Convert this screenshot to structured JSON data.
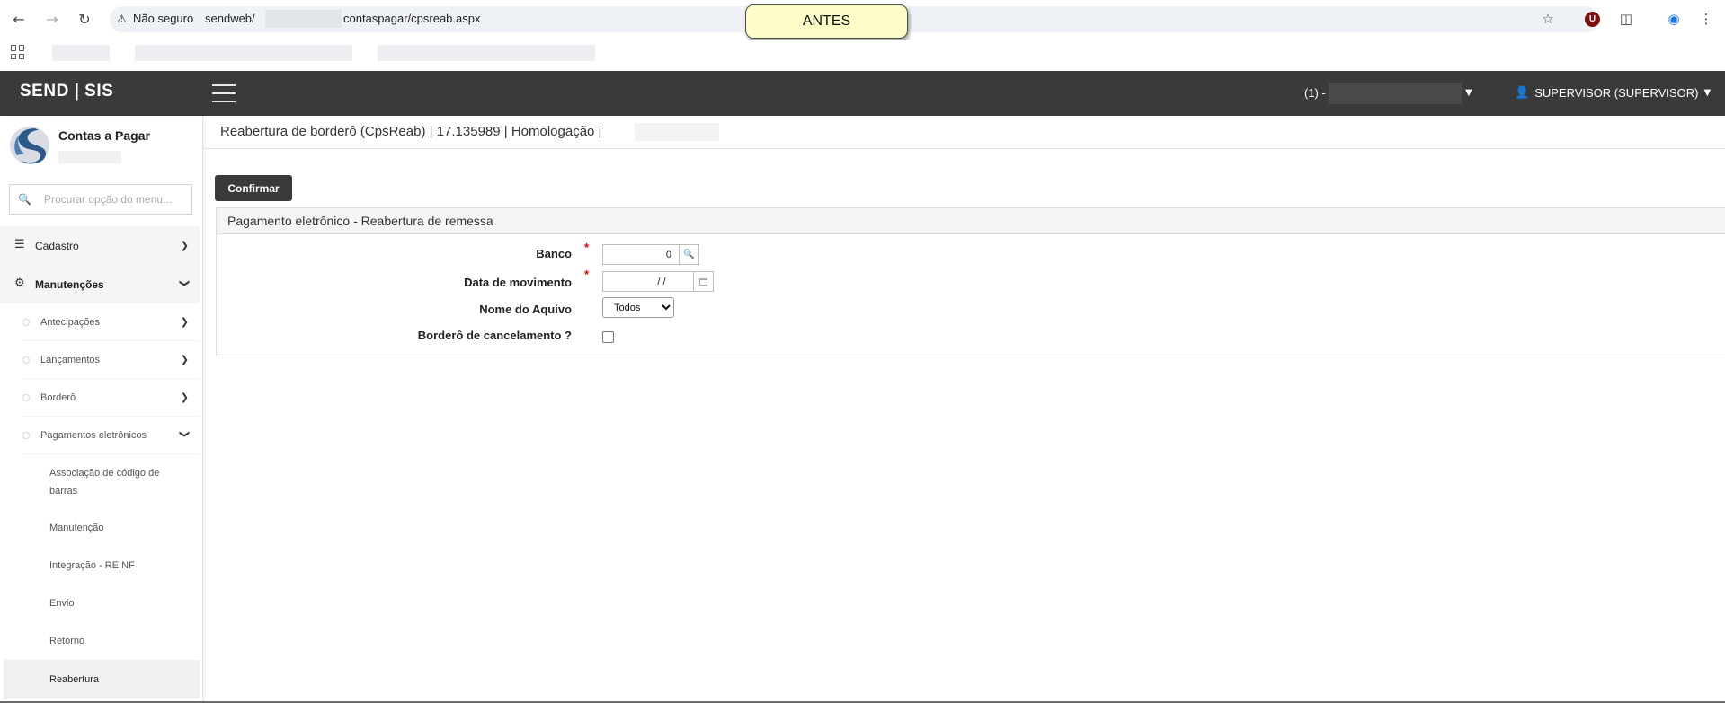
{
  "browser": {
    "security_label": "Não seguro",
    "url_prefix": "sendweb/",
    "url_suffix": "contaspagar/cpsreab.aspx",
    "annotation_label": "ANTES",
    "extension_letter": "U"
  },
  "header": {
    "brand": "SEND | SIS",
    "company_prefix": "(1) -",
    "user": "SUPERVISOR (SUPERVISOR)"
  },
  "sidebar": {
    "module_title": "Contas a Pagar",
    "search_placeholder": "Procurar opção do menu...",
    "groups": [
      {
        "label": "Cadastro"
      },
      {
        "label": "Manutenções"
      }
    ],
    "subgroups": [
      {
        "label": "Antecipações"
      },
      {
        "label": "Lançamentos"
      },
      {
        "label": "Borderô"
      },
      {
        "label": "Pagamentos eletrônicos"
      }
    ],
    "items": [
      {
        "label": "Associação de código de barras"
      },
      {
        "label": "Manutenção"
      },
      {
        "label": "Integração - REINF"
      },
      {
        "label": "Envio"
      },
      {
        "label": "Retorno"
      },
      {
        "label": "Reabertura"
      }
    ]
  },
  "main": {
    "breadcrumb": "Reabertura de borderô (CpsReab) | 17.135989 | Homologação |",
    "confirm_label": "Confirmar",
    "panel_title": "Pagamento eletrônico - Reabertura de remessa",
    "fields": {
      "banco_label": "Banco",
      "banco_value": "0",
      "data_label": "Data de movimento",
      "data_value": "/ /",
      "arquivo_label": "Nome do Aquivo",
      "arquivo_selected": "Todos",
      "cancelamento_label": "Borderô de cancelamento ?",
      "required_mark": "*"
    }
  }
}
